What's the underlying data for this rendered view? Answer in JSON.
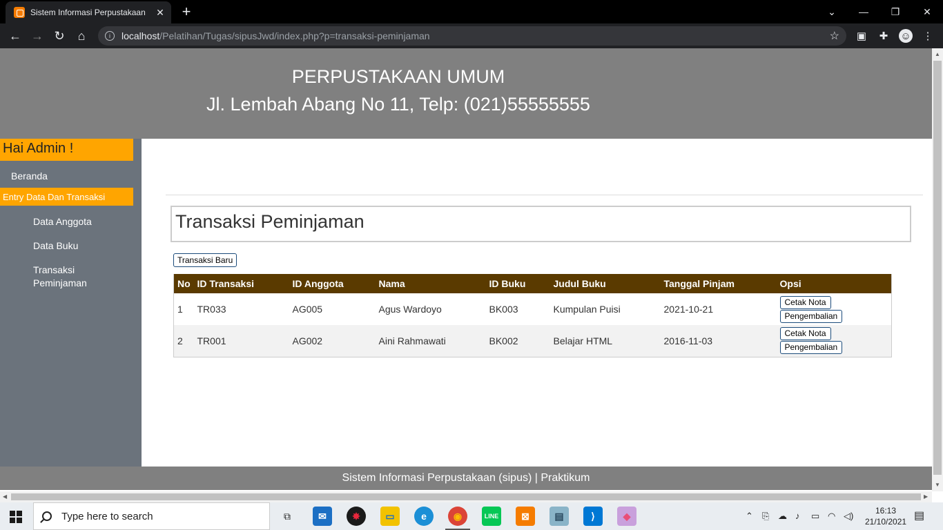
{
  "browser": {
    "tab_title": "Sistem Informasi Perpustakaan",
    "url_host": "localhost",
    "url_path": "/Pelatihan/Tugas/sipusJwd/index.php?p=transaksi-peminjaman"
  },
  "header": {
    "title": "PERPUSTAKAAN UMUM",
    "address": "Jl. Lembah Abang No 11, Telp: (021)55555555"
  },
  "sidebar": {
    "greeting": "Hai Admin !",
    "home": "Beranda",
    "section": "Entry Data Dan Transaksi",
    "items": [
      "Data Anggota",
      "Data Buku",
      "Transaksi",
      "Peminjaman"
    ]
  },
  "main": {
    "title": "Transaksi Peminjaman",
    "new_button": "Transaksi Baru",
    "columns": [
      "No",
      "ID Transaksi",
      "ID Anggota",
      "Nama",
      "ID Buku",
      "Judul Buku",
      "Tanggal Pinjam",
      "Opsi"
    ],
    "rows": [
      {
        "no": "1",
        "id_transaksi": "TR033",
        "id_anggota": "AG005",
        "nama": "Agus Wardoyo",
        "id_buku": "BK003",
        "judul": "Kumpulan Puisi",
        "tanggal": "2021-10-21"
      },
      {
        "no": "2",
        "id_transaksi": "TR001",
        "id_anggota": "AG002",
        "nama": "Aini Rahmawati",
        "id_buku": "BK002",
        "judul": "Belajar HTML",
        "tanggal": "2016-11-03"
      }
    ],
    "print_button": "Cetak Nota",
    "return_button": "Pengembalian"
  },
  "footer": {
    "text": "Sistem Informasi Perpustakaan (sipus) | Praktikum"
  },
  "taskbar": {
    "search_placeholder": "Type here to search",
    "time": "16:13",
    "date": "21/10/2021"
  },
  "colors": {
    "header_bg": "#808080",
    "sidebar_bg": "#6b737c",
    "accent": "#ffa500",
    "table_header": "#5a3a00"
  }
}
